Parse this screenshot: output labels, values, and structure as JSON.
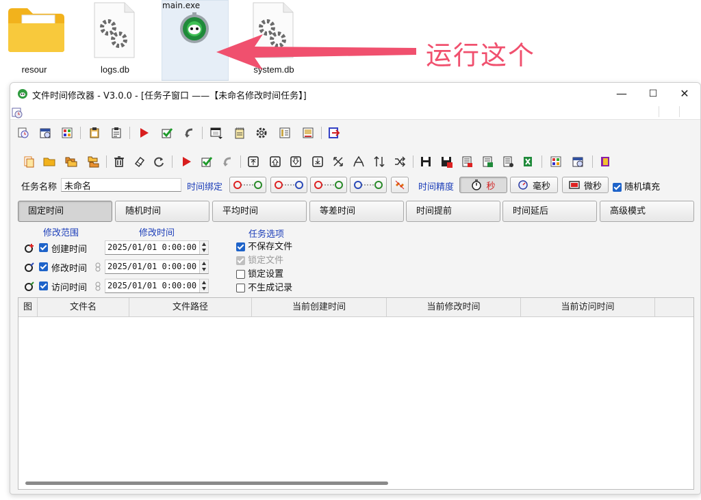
{
  "desktop": {
    "files": [
      {
        "name": "resour",
        "icon": "folder-icon"
      },
      {
        "name": "logs.db",
        "icon": "settings-file-icon"
      },
      {
        "name": "main.exe",
        "icon": "app-exe-icon"
      },
      {
        "name": "system.db",
        "icon": "settings-file-icon"
      }
    ],
    "annotation": "运行这个",
    "annotation_color": "#f0506e"
  },
  "window": {
    "title": "文件时间修改器  - V3.0.0 - [任务子窗口 ——【未命名修改时间任务】]",
    "controls": {
      "minimize": "—",
      "maximize": "☐",
      "close": "✕"
    }
  },
  "task": {
    "name_label": "任务名称",
    "name_value": "未命名",
    "bind_label": "时间绑定",
    "precision_label": "时间精度",
    "precision": {
      "second": "秒",
      "millisecond": "毫秒",
      "microsecond": "微秒"
    },
    "random_fill": "随机填充"
  },
  "tabs": [
    {
      "label": "固定时间",
      "active": true
    },
    {
      "label": "随机时间"
    },
    {
      "label": "平均时间"
    },
    {
      "label": "等差时间"
    },
    {
      "label": "时间提前"
    },
    {
      "label": "时间延后"
    },
    {
      "label": "高级模式"
    }
  ],
  "fixed": {
    "range_header": "修改范围",
    "time_header": "修改时间",
    "rows": [
      {
        "label": "创建时间",
        "value": "2025/01/01  0:00:00"
      },
      {
        "label": "修改时间",
        "value": "2025/01/01  0:00:00"
      },
      {
        "label": "访问时间",
        "value": "2025/01/01  0:00:00"
      }
    ]
  },
  "options": {
    "header": "任务选项",
    "items": [
      {
        "label": "不保存文件",
        "state": "checked"
      },
      {
        "label": "锁定文件",
        "state": "disabled"
      },
      {
        "label": "锁定设置",
        "state": "unchecked"
      },
      {
        "label": "不生成记录",
        "state": "unchecked"
      }
    ]
  },
  "table": {
    "columns": [
      "图",
      "文件名",
      "文件路径",
      "当前创建时间",
      "当前修改时间",
      "当前访问时间"
    ]
  }
}
